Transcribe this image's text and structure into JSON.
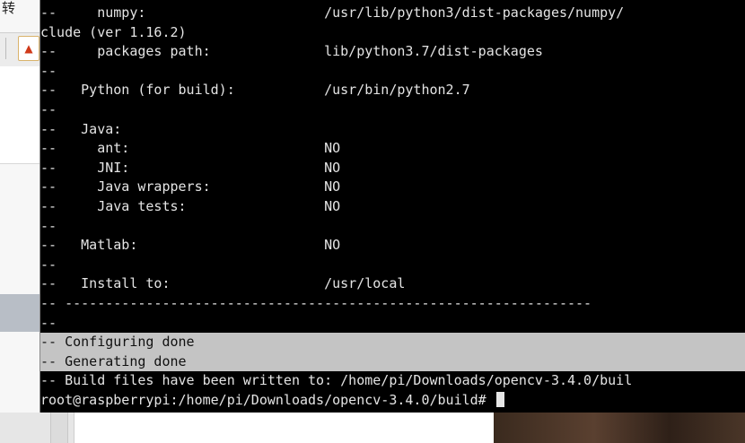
{
  "background_window": {
    "title_char": "转",
    "home_icon": "home-icon"
  },
  "terminal": {
    "lines": [
      "--     numpy:                      /usr/lib/python3/dist-packages/numpy/",
      "clude (ver 1.16.2)",
      "--     packages path:              lib/python3.7/dist-packages",
      "--",
      "--   Python (for build):           /usr/bin/python2.7",
      "--",
      "--   Java:",
      "--     ant:                        NO",
      "--     JNI:                        NO",
      "--     Java wrappers:              NO",
      "--     Java tests:                 NO",
      "--",
      "--   Matlab:                       NO",
      "--",
      "--   Install to:                   /usr/local",
      "-- -----------------------------------------------------------------",
      "--",
      "-- Configuring done",
      "-- Generating done",
      "-- Build files have been written to: /home/pi/Downloads/opencv-3.4.0/buil"
    ],
    "prompt": "root@raspberrypi:/home/pi/Downloads/opencv-3.4.0/build# "
  }
}
